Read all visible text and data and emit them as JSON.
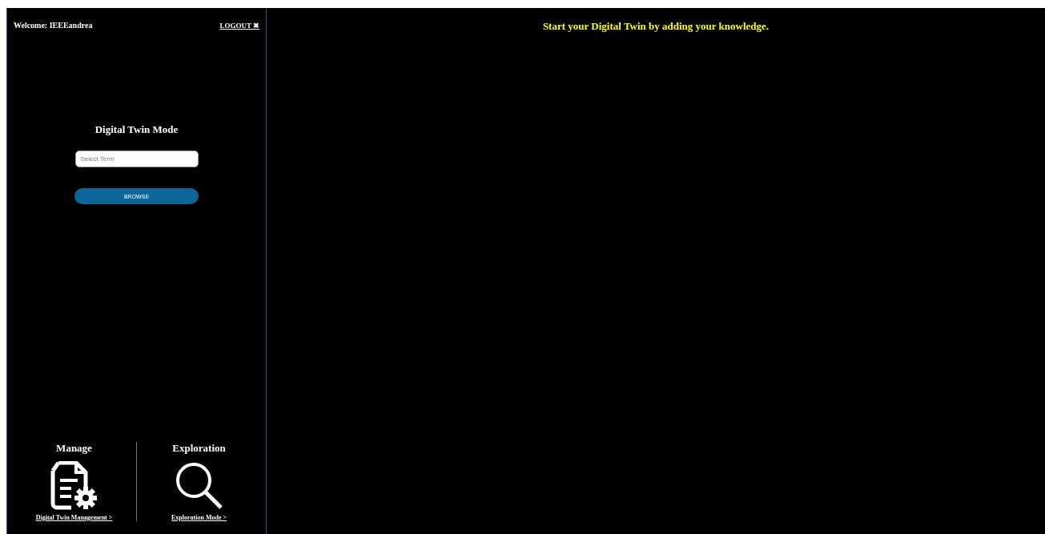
{
  "sidebar": {
    "welcome": "Welcome: IEEEandrea",
    "logout": "LOGOUT ✖",
    "mode_title": "Digital Twin Mode",
    "search": {
      "placeholder": "Select Term"
    },
    "browse_button": "BROWSE",
    "sections": [
      {
        "kind": "manage",
        "title": "Manage",
        "link": "Digital Twin Management >"
      },
      {
        "kind": "explore",
        "title": "Exploration",
        "link": "Exploration Mode >"
      }
    ]
  },
  "main": {
    "message": "Start your Digital Twin by adding your knowledge."
  }
}
